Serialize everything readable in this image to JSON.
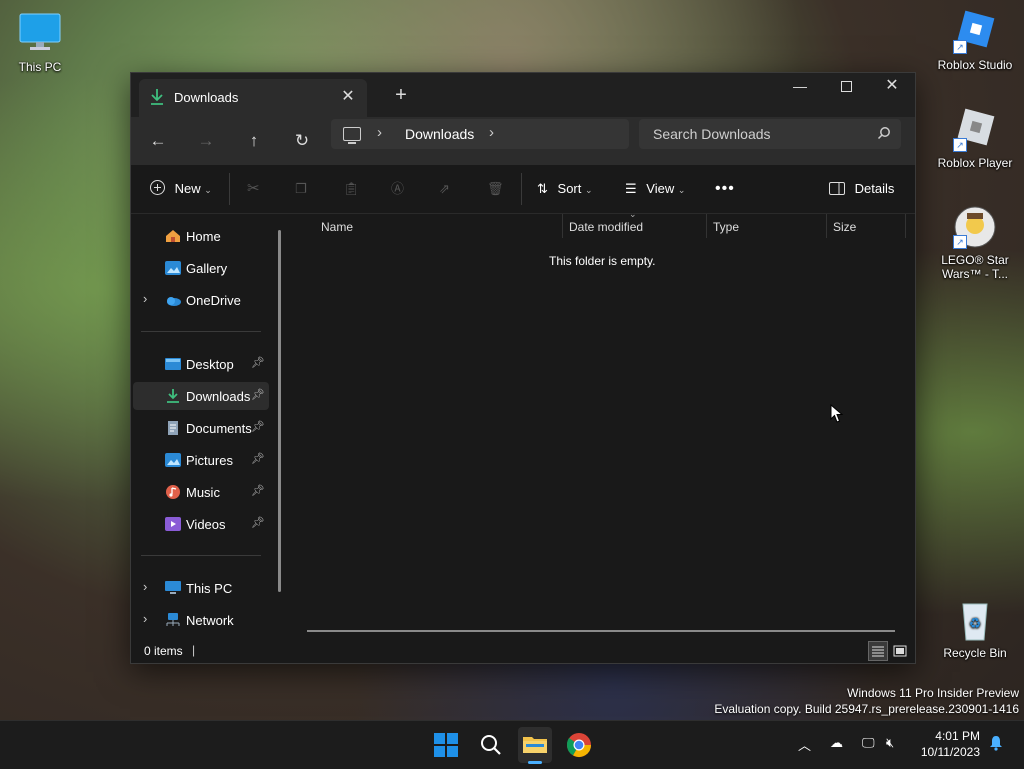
{
  "desktop": {
    "icons": {
      "this_pc": "This PC",
      "roblox_studio": "Roblox Studio",
      "roblox_player": "Roblox Player",
      "lego": "LEGO® Star Wars™ - T...",
      "recycle_bin": "Recycle Bin"
    },
    "watermark": {
      "line1": "Windows 11 Pro Insider Preview",
      "line2": "Evaluation copy. Build 25947.rs_prerelease.230901-1416"
    }
  },
  "window": {
    "tab_title": "Downloads",
    "address": {
      "crumb": "Downloads"
    },
    "search": {
      "placeholder": "Search Downloads"
    },
    "toolbar": {
      "new_label": "New",
      "sort_label": "Sort",
      "view_label": "View",
      "details_label": "Details"
    },
    "sidebar": {
      "home": "Home",
      "gallery": "Gallery",
      "onedrive": "OneDrive",
      "desktop": "Desktop",
      "downloads": "Downloads",
      "documents": "Documents",
      "pictures": "Pictures",
      "music": "Music",
      "videos": "Videos",
      "this_pc": "This PC",
      "network": "Network"
    },
    "columns": {
      "name": "Name",
      "date_modified": "Date modified",
      "type": "Type",
      "size": "Size"
    },
    "empty_message": "This folder is empty.",
    "status": "0 items"
  },
  "taskbar": {
    "time": "4:01 PM",
    "date": "10/11/2023"
  },
  "colors": {
    "accent": "#3fbf7f",
    "window_bg": "#191919",
    "taskbar_bg": "#1c1c1c"
  }
}
